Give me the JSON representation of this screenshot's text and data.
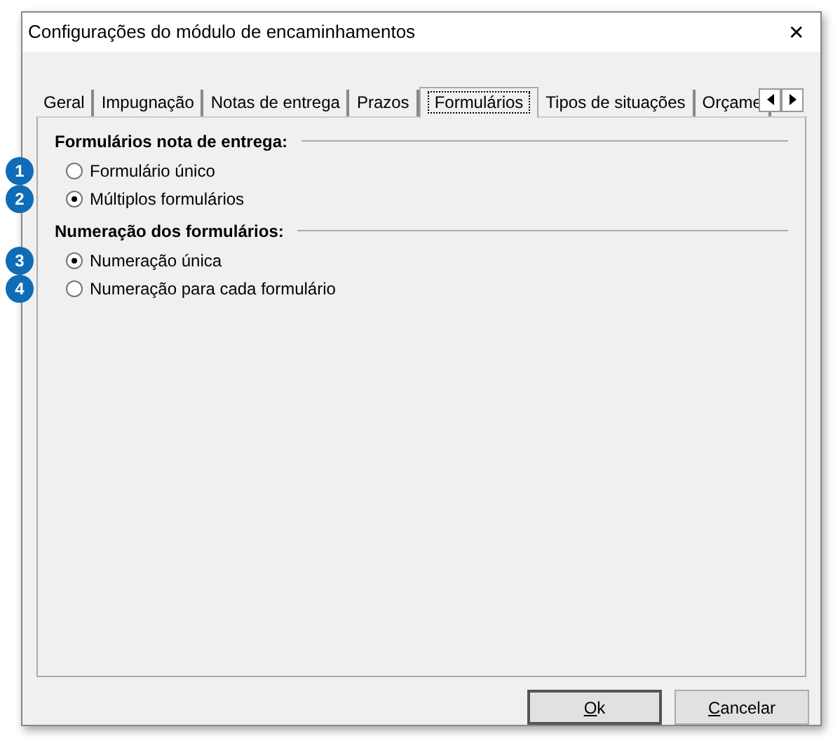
{
  "window": {
    "title": "Configurações do módulo de encaminhamentos",
    "close": "✕"
  },
  "tabs": [
    {
      "label": "Geral",
      "selected": false
    },
    {
      "label": "Impugnação",
      "selected": false
    },
    {
      "label": "Notas de entrega",
      "selected": false
    },
    {
      "label": "Prazos",
      "selected": false
    },
    {
      "label": "Formulários",
      "selected": true
    },
    {
      "label": "Tipos de situações",
      "selected": false
    },
    {
      "label": "Orçame",
      "selected": false
    }
  ],
  "groups": [
    {
      "title": "Formulários nota de entrega:",
      "options": [
        {
          "badge": "1",
          "label": "Formulário único",
          "selected": false
        },
        {
          "badge": "2",
          "label": "Múltiplos formulários",
          "selected": true
        }
      ]
    },
    {
      "title": "Numeração dos formulários:",
      "options": [
        {
          "badge": "3",
          "label": "Numeração única",
          "selected": true
        },
        {
          "badge": "4",
          "label": "Numeração para cada formulário",
          "selected": false
        }
      ]
    }
  ],
  "buttons": [
    {
      "mnemonic": "O",
      "rest": "k"
    },
    {
      "mnemonic": "C",
      "rest": "ancelar"
    }
  ]
}
